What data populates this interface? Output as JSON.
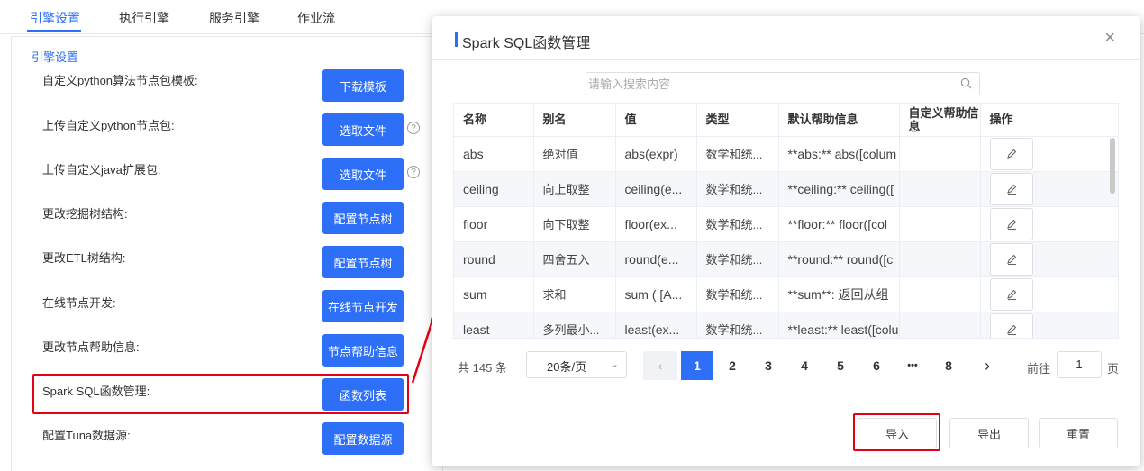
{
  "tabs": [
    "引擎设置",
    "执行引擎",
    "服务引擎",
    "作业流"
  ],
  "section_title": "引擎设置",
  "rows": [
    {
      "label": "自定义python算法节点包模板:",
      "button": "下载模板",
      "help": false
    },
    {
      "label": "上传自定义python节点包:",
      "button": "选取文件",
      "help": true
    },
    {
      "label": "上传自定义java扩展包:",
      "button": "选取文件",
      "help": true
    },
    {
      "label": "更改挖掘树结构:",
      "button": "配置节点树",
      "help": false
    },
    {
      "label": "更改ETL树结构:",
      "button": "配置节点树",
      "help": false
    },
    {
      "label": "在线节点开发:",
      "button": "在线节点开发",
      "help": false
    },
    {
      "label": "更改节点帮助信息:",
      "button": "节点帮助信息",
      "help": false
    },
    {
      "label": "Spark SQL函数管理:",
      "button": "函数列表",
      "help": false
    },
    {
      "label": "配置Tuna数据源:",
      "button": "配置数据源",
      "help": false
    }
  ],
  "modal": {
    "title": "Spark SQL函数管理",
    "close": "×",
    "search_placeholder": "请输入搜索内容",
    "columns": [
      "名称",
      "别名",
      "值",
      "类型",
      "默认帮助信息",
      "自定义帮助信息",
      "操作"
    ],
    "rows": [
      [
        "abs",
        "绝对值",
        "abs(expr)",
        "数学和统...",
        "**abs:** abs([colum"
      ],
      [
        "ceiling",
        "向上取整",
        "ceiling(e...",
        "数学和统...",
        "**ceiling:** ceiling(["
      ],
      [
        "floor",
        "向下取整",
        "floor(ex...",
        "数学和统...",
        "**floor:** floor([col"
      ],
      [
        "round",
        "四舍五入",
        "round(e...",
        "数学和统...",
        "**round:** round([c"
      ],
      [
        "sum",
        "求和",
        "sum ( [A...",
        "数学和统...",
        "**sum**:  返回从组"
      ],
      [
        "least",
        "多列最小...",
        "least(ex...",
        "数学和统...",
        "**least:** least([colu"
      ]
    ],
    "pagination": {
      "total": "共 145 条",
      "page_size": "20条/页",
      "prev": "‹",
      "pages": [
        "1",
        "2",
        "3",
        "4",
        "5",
        "6",
        "•••",
        "8"
      ],
      "current": "1",
      "next": "›",
      "goto_label": "前往",
      "goto_value": "1",
      "goto_unit": "页"
    },
    "buttons": {
      "import": "导入",
      "export": "导出",
      "reset": "重置"
    }
  },
  "colors": {
    "accent": "#2d6ff7",
    "highlight": "#e60012"
  }
}
